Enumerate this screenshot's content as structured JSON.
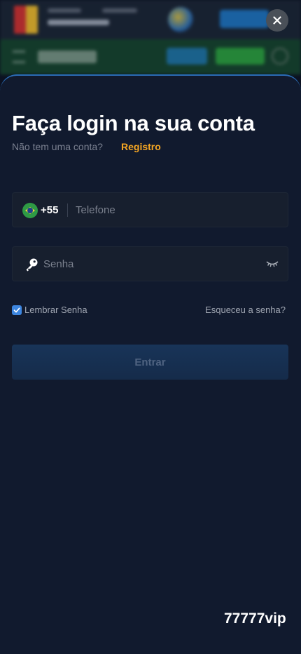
{
  "login": {
    "title": "Faça login na sua conta",
    "subtitle": "Não tem uma conta?",
    "register_link": "Registro",
    "phone": {
      "country_code": "+55",
      "placeholder": "Telefone"
    },
    "password": {
      "placeholder": "Senha"
    },
    "remember_label": "Lembrar Senha",
    "remember_checked": true,
    "forgot_link": "Esqueceu a senha?",
    "submit_label": "Entrar"
  },
  "watermark": "77777vip",
  "icons": {
    "close": "close-icon",
    "flag": "brazil-flag-icon",
    "key": "key-icon",
    "eye": "eye-closed-icon",
    "check": "check-icon"
  },
  "colors": {
    "sheet_background": "#111a2e",
    "accent_orange": "#f5a623",
    "checkbox_blue": "#3d86e0",
    "submit_bg": "#152b4a",
    "border_top": "#2a6cb6"
  }
}
